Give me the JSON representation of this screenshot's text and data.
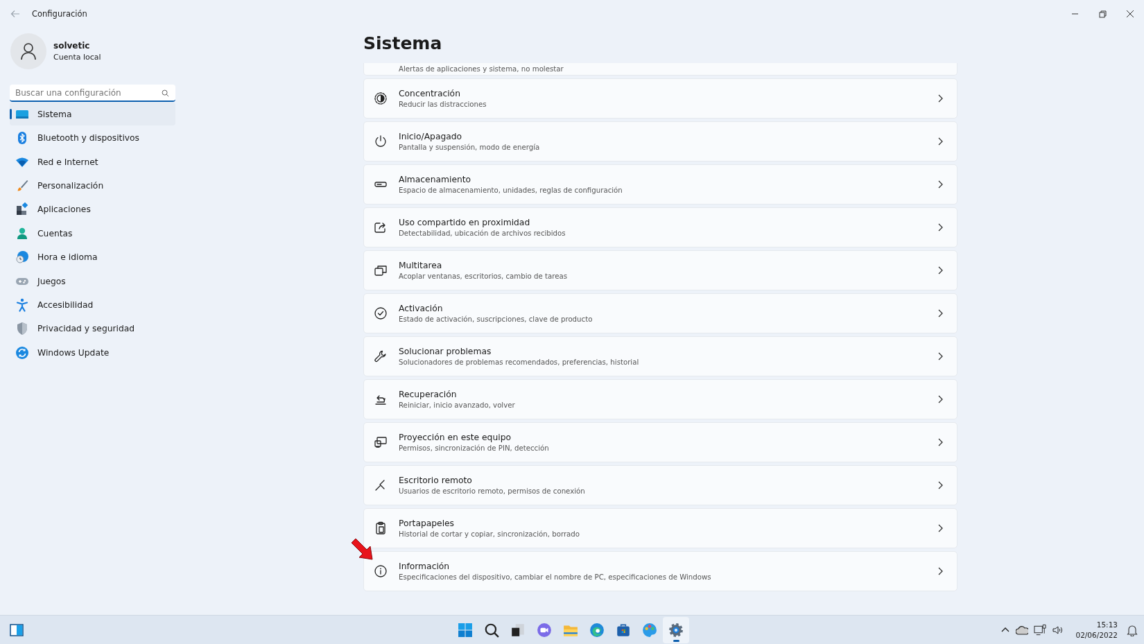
{
  "window": {
    "title": "Configuración"
  },
  "user": {
    "name": "solvetic",
    "account": "Cuenta local"
  },
  "search": {
    "placeholder": "Buscar una configuración"
  },
  "sidebar": {
    "items": [
      {
        "kind": "system",
        "label": "Sistema",
        "selected": true
      },
      {
        "kind": "bluetooth",
        "label": "Bluetooth y dispositivos",
        "selected": false
      },
      {
        "kind": "network",
        "label": "Red e Internet",
        "selected": false
      },
      {
        "kind": "brush",
        "label": "Personalización",
        "selected": false
      },
      {
        "kind": "apps",
        "label": "Aplicaciones",
        "selected": false
      },
      {
        "kind": "accounts",
        "label": "Cuentas",
        "selected": false
      },
      {
        "kind": "time",
        "label": "Hora e idioma",
        "selected": false
      },
      {
        "kind": "gaming",
        "label": "Juegos",
        "selected": false
      },
      {
        "kind": "accessibility",
        "label": "Accesibilidad",
        "selected": false
      },
      {
        "kind": "privacy",
        "label": "Privacidad y seguridad",
        "selected": false
      },
      {
        "kind": "update",
        "label": "Windows Update",
        "selected": false
      }
    ]
  },
  "page": {
    "title": "Sistema",
    "cards": [
      {
        "kind": "partial",
        "subtitle": "Alertas de aplicaciones y sistema, no molestar"
      },
      {
        "kind": "focus",
        "title": "Concentración",
        "subtitle": "Reducir las distracciones"
      },
      {
        "kind": "power",
        "title": "Inicio/Apagado",
        "subtitle": "Pantalla y suspensión, modo de energía"
      },
      {
        "kind": "storage",
        "title": "Almacenamiento",
        "subtitle": "Espacio de almacenamiento, unidades, reglas de configuración"
      },
      {
        "kind": "share",
        "title": "Uso compartido en proximidad",
        "subtitle": "Detectabilidad, ubicación de archivos recibidos"
      },
      {
        "kind": "multitask",
        "title": "Multitarea",
        "subtitle": "Acoplar ventanas, escritorios, cambio de tareas"
      },
      {
        "kind": "activation",
        "title": "Activación",
        "subtitle": "Estado de activación, suscripciones, clave de producto"
      },
      {
        "kind": "troubleshoot",
        "title": "Solucionar problemas",
        "subtitle": "Solucionadores de problemas recomendados, preferencias, historial"
      },
      {
        "kind": "recovery",
        "title": "Recuperación",
        "subtitle": "Reiniciar, inicio avanzado, volver"
      },
      {
        "kind": "projection",
        "title": "Proyección en este equipo",
        "subtitle": "Permisos, sincronización de PIN, detección"
      },
      {
        "kind": "remote",
        "title": "Escritorio remoto",
        "subtitle": "Usuarios de escritorio remoto, permisos de conexión"
      },
      {
        "kind": "clipboard",
        "title": "Portapapeles",
        "subtitle": "Historial de cortar y copiar, sincronización, borrado"
      },
      {
        "kind": "info",
        "title": "Información",
        "subtitle": "Especificaciones del dispositivo, cambiar el nombre de PC, especificaciones de Windows"
      }
    ]
  },
  "taskbar": {
    "apps": [
      {
        "kind": "start",
        "selected": false
      },
      {
        "kind": "search",
        "selected": false
      },
      {
        "kind": "taskview",
        "selected": false
      },
      {
        "kind": "chat",
        "selected": false
      },
      {
        "kind": "folder",
        "selected": false
      },
      {
        "kind": "browser",
        "selected": false
      },
      {
        "kind": "store",
        "selected": false
      },
      {
        "kind": "paint",
        "selected": false
      },
      {
        "kind": "settings",
        "selected": true
      }
    ],
    "time": "15:13",
    "date": "02/06/2022"
  }
}
